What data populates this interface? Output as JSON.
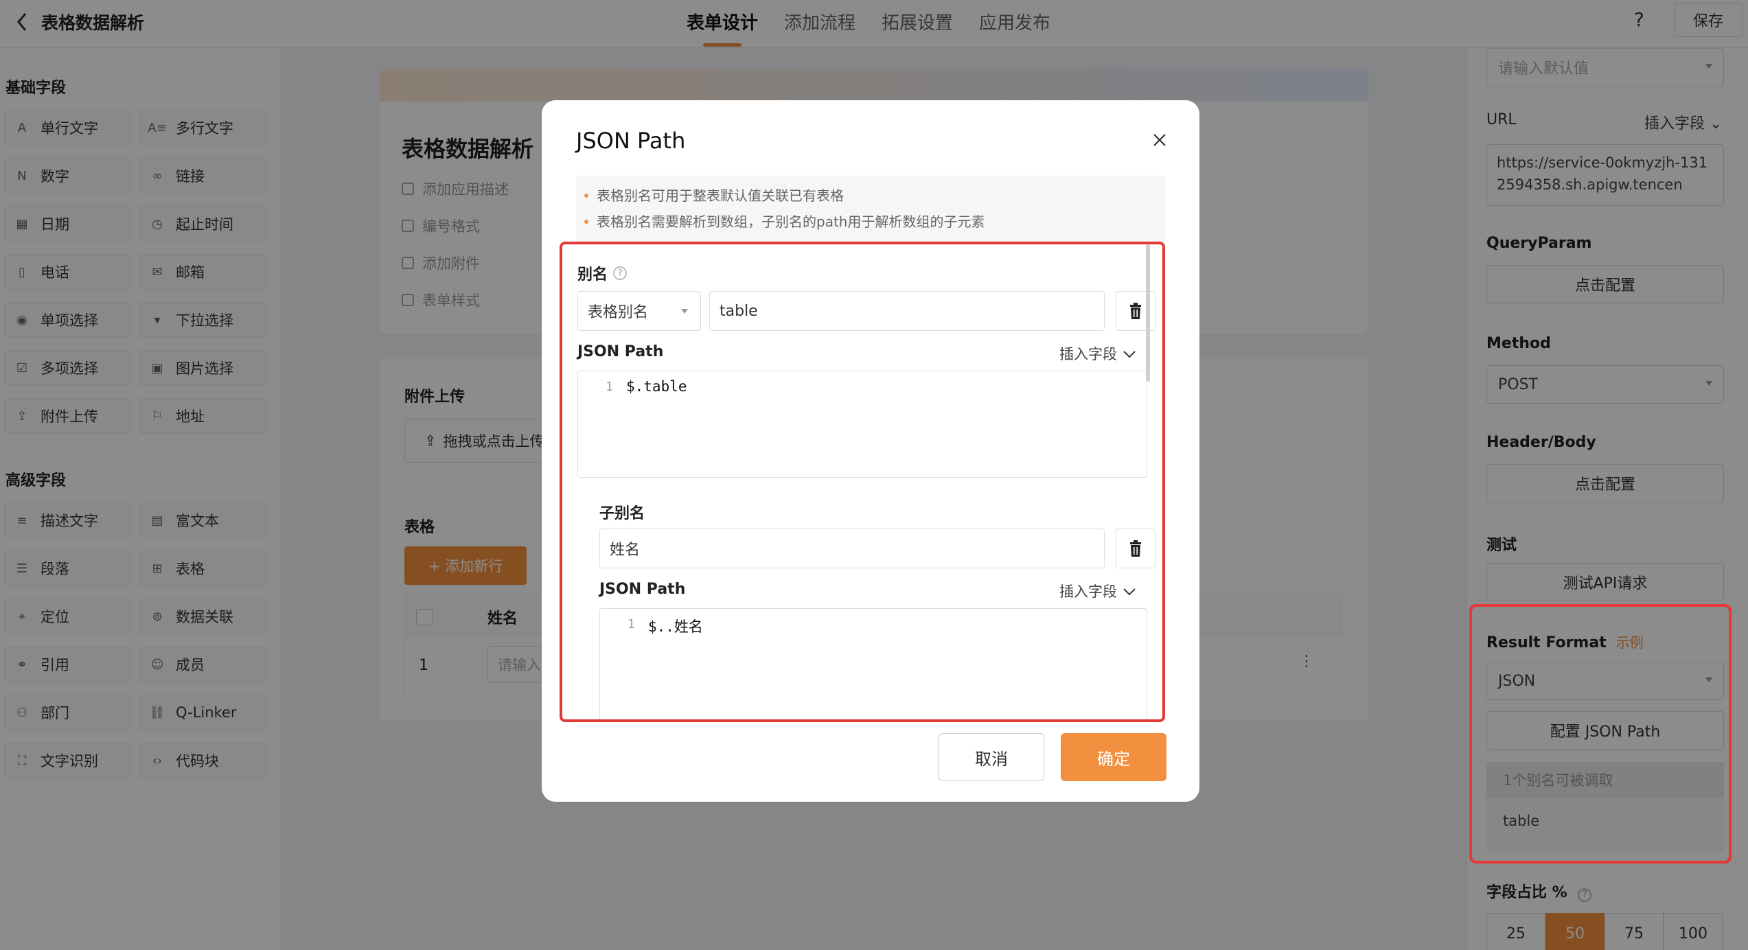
{
  "topbar": {
    "title": "表格数据解析",
    "tabs": [
      "表单设计",
      "添加流程",
      "拓展设置",
      "应用发布"
    ],
    "active_tab": "表单设计",
    "help": "?",
    "save_label": "保存"
  },
  "left_panel": {
    "basic_title": "基础字段",
    "basic_fields": [
      "单行文字",
      "多行文字",
      "数字",
      "链接",
      "日期",
      "起止时间",
      "电话",
      "邮箱",
      "单项选择",
      "下拉选择",
      "多项选择",
      "图片选择",
      "附件上传",
      "地址"
    ],
    "advanced_title": "高级字段",
    "advanced_fields": [
      "描述文字",
      "富文本",
      "段落",
      "表格",
      "定位",
      "数据关联",
      "引用",
      "成员",
      "部门",
      "Q-Linker",
      "文字识别",
      "代码块"
    ]
  },
  "center": {
    "form_title": "表格数据解析",
    "options": [
      "添加应用描述",
      "编号格式",
      "添加附件",
      "表单样式"
    ],
    "upload_label": "附件上传",
    "upload_button": "拖拽或点击上传",
    "table_label": "表格",
    "add_row": "+ 添加新行",
    "table_column": "姓名",
    "row_number": "1",
    "cell_placeholder": "请输入"
  },
  "right_panel": {
    "default_placeholder": "请输入默认值",
    "url_label": "URL",
    "insert_field": "插入字段",
    "url_value": "https://service-0okmyzjh-1312594358.sh.apigw.tencen",
    "queryparam_label": "QueryParam",
    "configure": "点击配置",
    "method_label": "Method",
    "method_value": "POST",
    "headerbody_label": "Header/Body",
    "test_label": "测试",
    "test_button": "测试API请求",
    "result_format_label": "Result Format",
    "example": "示例",
    "result_format_value": "JSON",
    "config_jsonpath": "配置 JSON Path",
    "alias_count": "1个别名可被调取",
    "alias_value": "table",
    "ratio_label": "字段占比 %",
    "ratio_options": [
      "25",
      "50",
      "75",
      "100"
    ],
    "ratio_active": "50"
  },
  "modal": {
    "title": "JSON Path",
    "tips": [
      "表格别名可用于整表默认值关联已有表格",
      "表格别名需要解析到数组，子别名的path用于解析数组的子元素"
    ],
    "alias_label": "别名",
    "alias_type": "表格别名",
    "alias_value": "table",
    "jsonpath_label": "JSON Path",
    "insert_field": "插入字段",
    "line_number": "1",
    "jsonpath_code": "$.table",
    "sub_alias_label": "子别名",
    "sub_alias_value": "姓名",
    "sub_jsonpath_label": "JSON Path",
    "sub_insert_field": "插入字段",
    "sub_line_number": "1",
    "sub_jsonpath_code": "$..姓名",
    "cancel": "取消",
    "confirm": "确定"
  },
  "colors": {
    "accent": "#f3903f",
    "highlight": "#e53935",
    "overlay": "rgba(0,0,0,0.45)"
  },
  "icons": [
    "back-icon",
    "close-icon",
    "trash-icon",
    "chevron-down-icon",
    "help-icon",
    "upload-icon"
  ]
}
